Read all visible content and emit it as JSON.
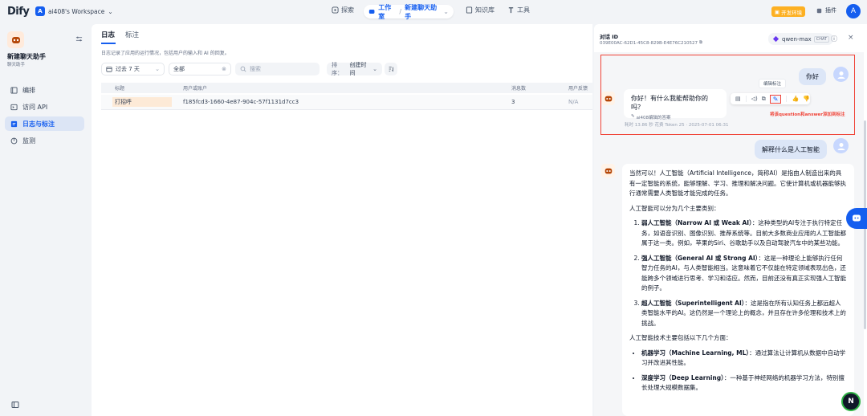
{
  "topbar": {
    "logo": "Dify",
    "workspace_initial": "A",
    "workspace_name": "ai408's Workspace",
    "nav_explore": "探索",
    "nav_studio": "工作室",
    "nav_current_app": "新建聊天助手",
    "nav_knowledge": "知识库",
    "nav_tools": "工具",
    "env_badge": "开发环境",
    "plugins": "插件",
    "user_initial": "A"
  },
  "sidebar": {
    "app_name": "新建聊天助手",
    "app_type": "聊天助手",
    "items": [
      {
        "label": "编排",
        "icon": "orchestrate-icon"
      },
      {
        "label": "访问 API",
        "icon": "api-icon"
      },
      {
        "label": "日志与标注",
        "icon": "logs-icon"
      },
      {
        "label": "监测",
        "icon": "monitor-icon"
      }
    ]
  },
  "main": {
    "tabs": [
      "日志",
      "标注"
    ],
    "description": "日志记录了应用的运行情况，包括用户的输入和 AI 的回复。",
    "filter_period": "过去 7 天",
    "filter_status": "全部",
    "search_placeholder": "搜索",
    "sort_label": "排序：",
    "sort_value": "创建时间",
    "columns": [
      "标题",
      "用户或账户",
      "消息数",
      "用户反馈"
    ],
    "rows": [
      {
        "title": "打招呼",
        "user": "f185fcd3-1660-4e87-904c-57f1131d7cc3",
        "messages": "3",
        "feedback": "N/A"
      }
    ]
  },
  "panel": {
    "convo_label": "对话 ID",
    "convo_id": "039E00AC-62D1-45C8-829B-E4E76C210527",
    "model_name": "qwen-max",
    "model_mode": "CHAT",
    "q1": "你好",
    "a1": "你好！有什么我能帮助你的吗？",
    "a1_edited": "ai408编辑的答案",
    "tooltip": "编辑标注",
    "annotation_note": "将该question和answer添加到标注",
    "meta": "耗时 13.86 秒   花费 Token 25   ·   2025-07-01 06:31",
    "q2": "解释什么是人工智能",
    "answer": {
      "intro": "当然可以！人工智能（Artificial Intelligence，简称AI）是指由人制造出来的具有一定智能的系统，能够理解、学习、推理和解决问题。它使计算机或机器能够执行通常需要人类智能才能完成的任务。",
      "types_intro": "人工智能可以分为几个主要类别：",
      "types": [
        {
          "name": "弱人工智能（Narrow AI 或 Weak AI）",
          "desc": "：这种类型的AI专注于执行特定任务，如语音识别、图像识别、推荐系统等。目前大多数商业应用的人工智能都属于这一类。例如，苹果的Siri、谷歌助手以及自动驾驶汽车中的某些功能。"
        },
        {
          "name": "强人工智能（General AI 或 Strong AI）",
          "desc": "：这是一种理论上能够执行任何智力任务的AI，与人类智能相当。这意味着它不仅能在特定领域表现出色，还能跨多个领域进行思考、学习和适应。然而，目前还没有真正实现强人工智能的例子。"
        },
        {
          "name": "超人工智能（Superintelligent AI）",
          "desc": "：这是指在所有认知任务上都远超人类智能水平的AI。这仍然是一个理论上的概念，并且存在许多伦理和技术上的挑战。"
        }
      ],
      "tech_intro": "人工智能技术主要包括以下几个方面：",
      "tech": [
        {
          "name": "机器学习（Machine Learning, ML）",
          "desc": "：通过算法让计算机从数据中自动学习并改进其性能。"
        },
        {
          "name": "深度学习（Deep Learning）",
          "desc": "：一种基于神经网络的机器学习方法，特别擅长处理大规模数据集。"
        }
      ]
    }
  },
  "fab": "N"
}
